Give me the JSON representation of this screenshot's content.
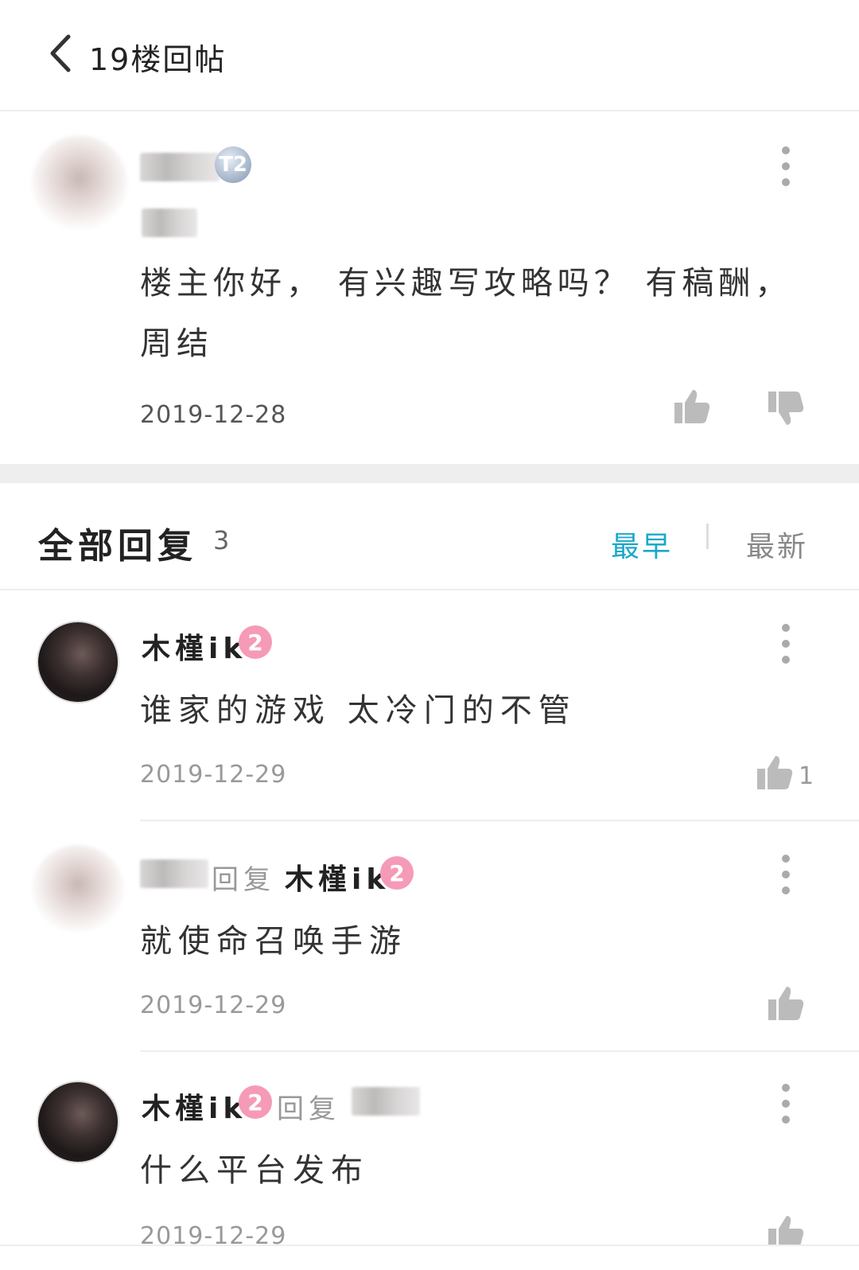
{
  "header": {
    "title": "19楼回帖"
  },
  "main_post": {
    "text_line1": "楼主你好， 有兴趣写攻略吗？ 有稿酬，",
    "text_line2": "周结",
    "date": "2019-12-28",
    "badge": "T2"
  },
  "replies_section": {
    "title": "全部回复",
    "count": "3",
    "sort_earliest": "最早",
    "sort_newest": "最新"
  },
  "replies": [
    {
      "user": "木槿ik",
      "level": "2",
      "text": "谁家的游戏 太冷门的不管",
      "date": "2019-12-29",
      "likes": "1"
    },
    {
      "reply_word": "回复",
      "target_user": "木槿ik",
      "target_level": "2",
      "text": "就使命召唤手游",
      "date": "2019-12-29"
    },
    {
      "user": "木槿ik",
      "level": "2",
      "reply_word": "回复",
      "text": "什么平台发布",
      "date": "2019-12-29"
    }
  ],
  "colors": {
    "accent": "#1ba8c9",
    "level_badge": "#f59ab7",
    "separator": "#eeeeee"
  },
  "icons": [
    "back-arrow-icon",
    "more-icon",
    "thumb-up-icon",
    "thumb-down-icon"
  ]
}
